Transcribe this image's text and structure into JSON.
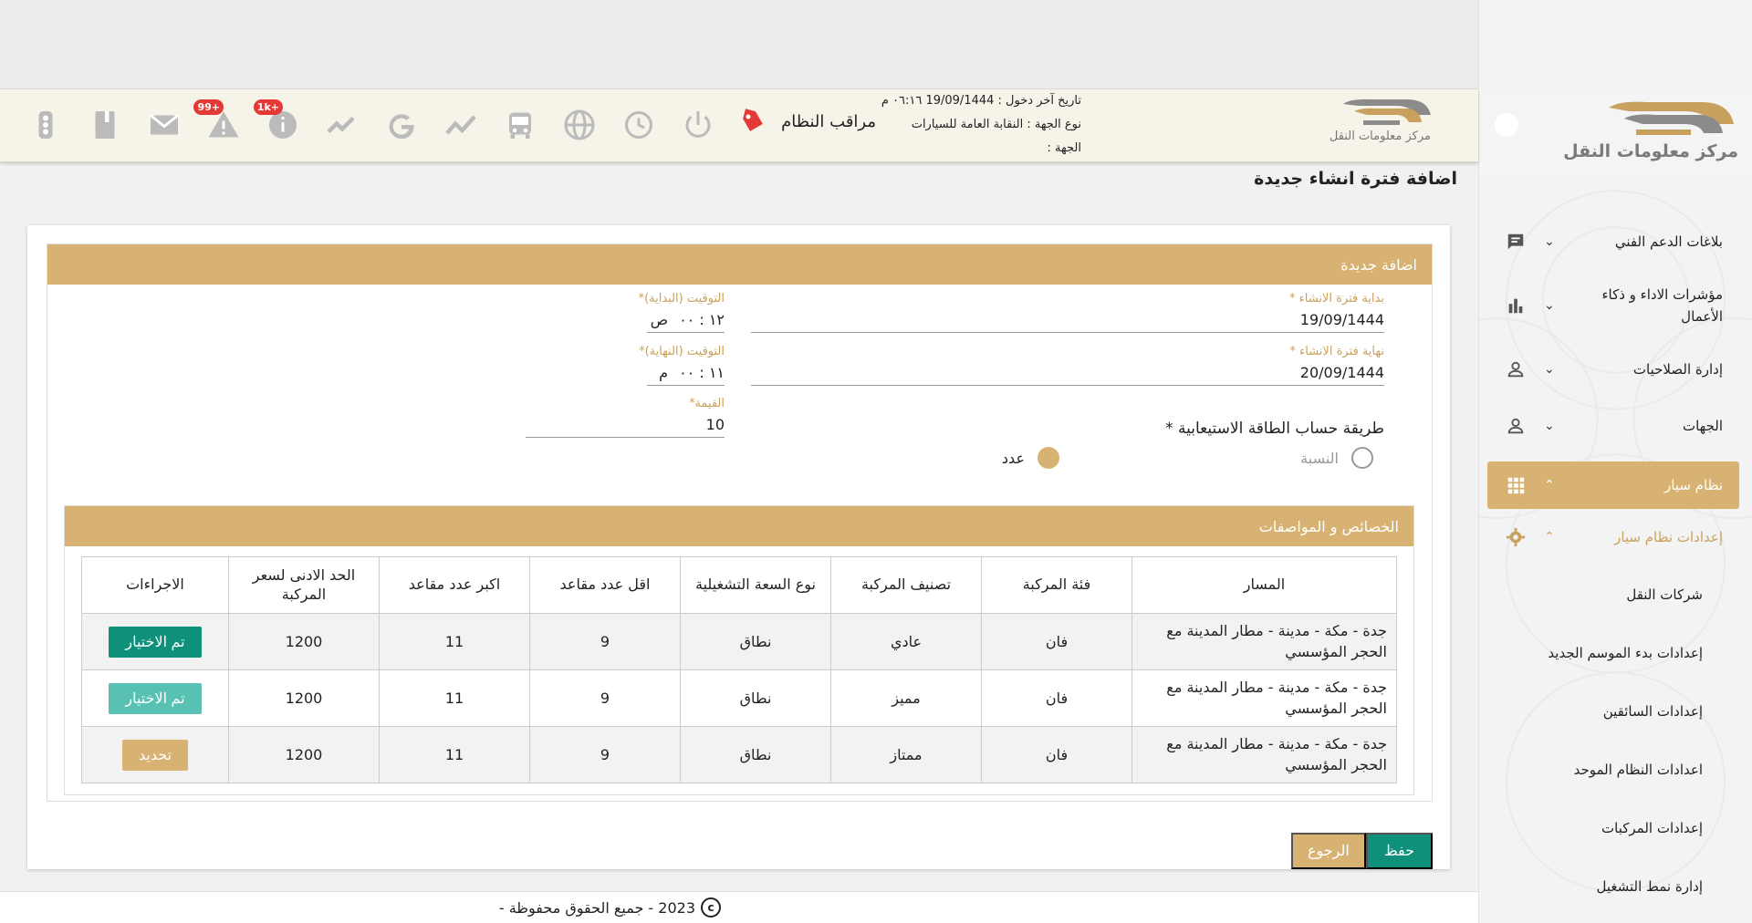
{
  "brand": {
    "name": "مركز معلومات النقل",
    "colors": {
      "gold": "#d7b272",
      "teal": "#0e907a",
      "teal_light": "#58c1b4",
      "badge_red": "#e53935"
    }
  },
  "header": {
    "last_login": "تاريخ آخر دخول : 19/09/1444 ٠٦:١٦ م",
    "entity_type": "نوع الجهة : النقابة العامة للسيارات",
    "entity": "الجهة :",
    "user_role": "مراقب النظام",
    "badges": {
      "alerts": "+99",
      "info": "+1k"
    },
    "icons": [
      "tag-icon",
      "traffic-light-icon",
      "book-icon",
      "mail-icon",
      "warning-icon",
      "info-icon",
      "trend-icon",
      "google-icon",
      "analytics-icon",
      "bus-icon",
      "globe-icon",
      "history-icon",
      "power-icon"
    ]
  },
  "sidebar": {
    "items": [
      {
        "label": "بلاغات الدعم الفني",
        "icon": "chat-icon"
      },
      {
        "label": "مؤشرات الاداء و ذكاء الأعمال",
        "icon": "bar-chart-icon"
      },
      {
        "label": "إدارة الصلاحيات",
        "icon": "user-icon"
      },
      {
        "label": "الجهات",
        "icon": "user-icon"
      },
      {
        "label": "نظام سيار",
        "icon": "apps-icon"
      },
      {
        "label": "إعدادات نظام سيار",
        "icon": "gear-icon"
      }
    ],
    "sub_items": [
      "شركات النقل",
      "إعدادات بدء الموسم الجديد",
      "إعدادات السائقين",
      "اعدادات النظام الموحد",
      "إعدادات المركبات",
      "إدارة نمط التشغيل"
    ]
  },
  "page": {
    "title": "اضافة فترة انشاء جديدة",
    "panel_title": "اضافة جديدة",
    "form": {
      "start_label": "بداية فترة الانشاء *",
      "start_value": "19/09/1444",
      "end_label": "نهاية فترة الانشاء *",
      "end_value": "20/09/1444",
      "time_start_label": "التوقيت (البداية)*",
      "time_start_value": "١٢ : ٠٠",
      "time_start_period": "ص",
      "time_end_label": "التوقيت (النهاية)*",
      "time_end_value": "١١ : ٠٠",
      "time_end_period": "م",
      "value_label": "القيمة*",
      "value": "10",
      "calc_label": "طريقة حساب الطاقة الاستيعابية *",
      "option_ratio": "النسبة",
      "option_count": "عدد"
    },
    "specs_title": "الخصائص و المواصفات",
    "table": {
      "headers": [
        "المسار",
        "فئة المركبة",
        "تصنيف المركبة",
        "نوع السعة التشغيلية",
        "اقل عدد مقاعد",
        "اكبر عدد مقاعد",
        "الحد الادنى لسعر المركبة",
        "الاجراءات"
      ],
      "rows": [
        {
          "path": "جدة - مكة - مدينة - مطار المدينة مع الحجر المؤسسي",
          "category": "فان",
          "class": "عادي",
          "capacity": "نطاق",
          "min": "9",
          "max": "11",
          "price": "1200",
          "action": "تم الاختيار"
        },
        {
          "path": "جدة - مكة - مدينة - مطار المدينة مع الحجر المؤسسي",
          "category": "فان",
          "class": "مميز",
          "capacity": "نطاق",
          "min": "9",
          "max": "11",
          "price": "1200",
          "action": "تم الاختيار"
        },
        {
          "path": "جدة - مكة - مدينة - مطار المدينة مع الحجر المؤسسي",
          "category": "فان",
          "class": "ممتاز",
          "capacity": "نطاق",
          "min": "9",
          "max": "11",
          "price": "1200",
          "action": "تحديد"
        }
      ]
    },
    "save": "حفظ",
    "back": "الرجوع"
  },
  "footer": {
    "text": "2023 - جميع الحقوق محفوظة -"
  }
}
